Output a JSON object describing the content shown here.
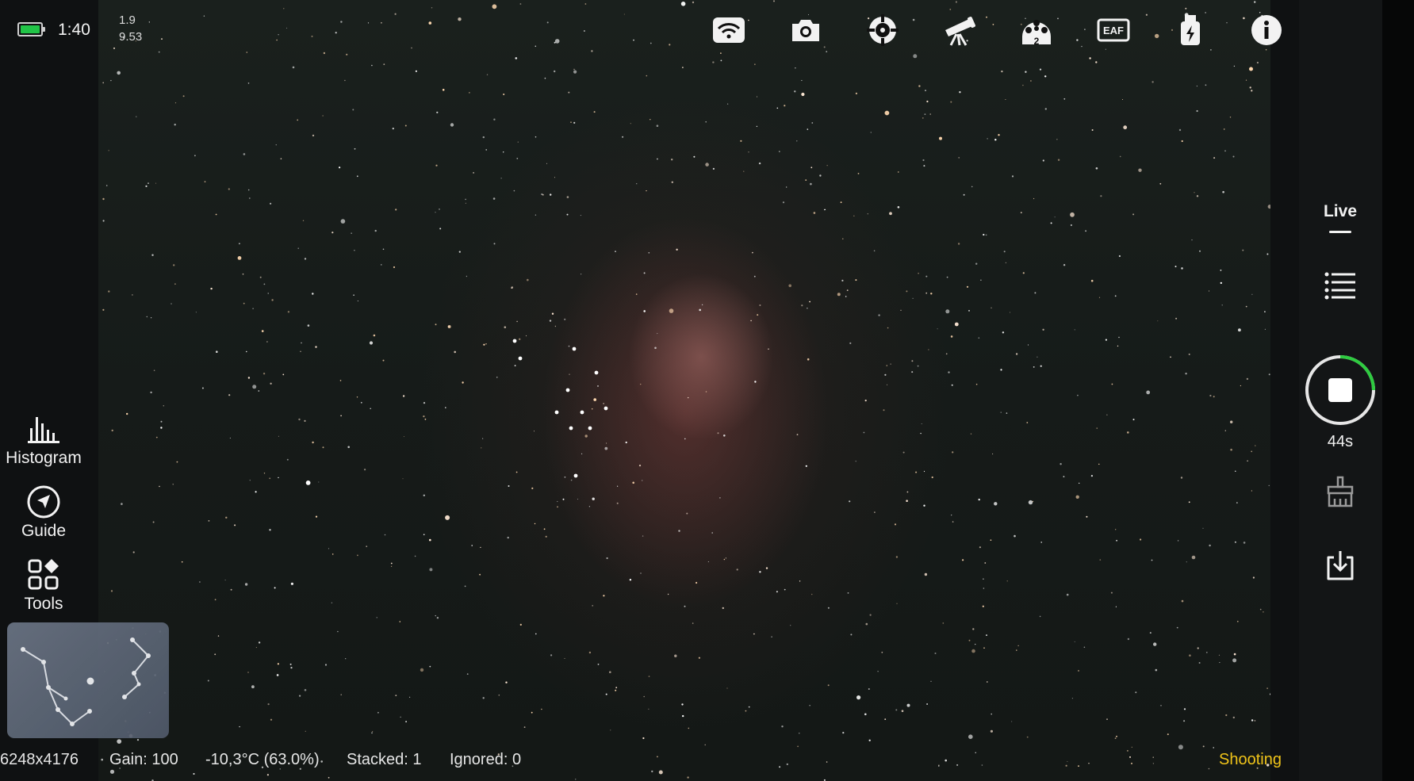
{
  "status": {
    "time": "1:40",
    "stat_top": "1.9",
    "stat_bottom": "9.53",
    "battery_color": "#21c447"
  },
  "toolbar": {
    "icons": [
      "wifi-icon",
      "camera-icon",
      "crosshair-target-icon",
      "telescope-icon",
      "filter-wheel-icon",
      "eaf-focuser-icon",
      "power-hub-icon",
      "info-icon"
    ],
    "filter_wheel_number": "2",
    "eaf_label": "EAF"
  },
  "left_panel": {
    "histogram_label": "Histogram",
    "guide_label": "Guide",
    "tools_label": "Tools"
  },
  "right_panel": {
    "live_label": "Live",
    "countdown": "44s",
    "ring_color": "#2ecc40",
    "icons": [
      "list-icon",
      "stop-icon",
      "broom-icon",
      "download-icon"
    ]
  },
  "bottom_bar": {
    "resolution": "6248x4176",
    "gain": "Gain: 100",
    "temperature": "-10,3°C  (63.0%)",
    "stacked": "Stacked: 1",
    "ignored": "Ignored: 0",
    "status": "Shooting",
    "status_color": "#f0c419"
  }
}
